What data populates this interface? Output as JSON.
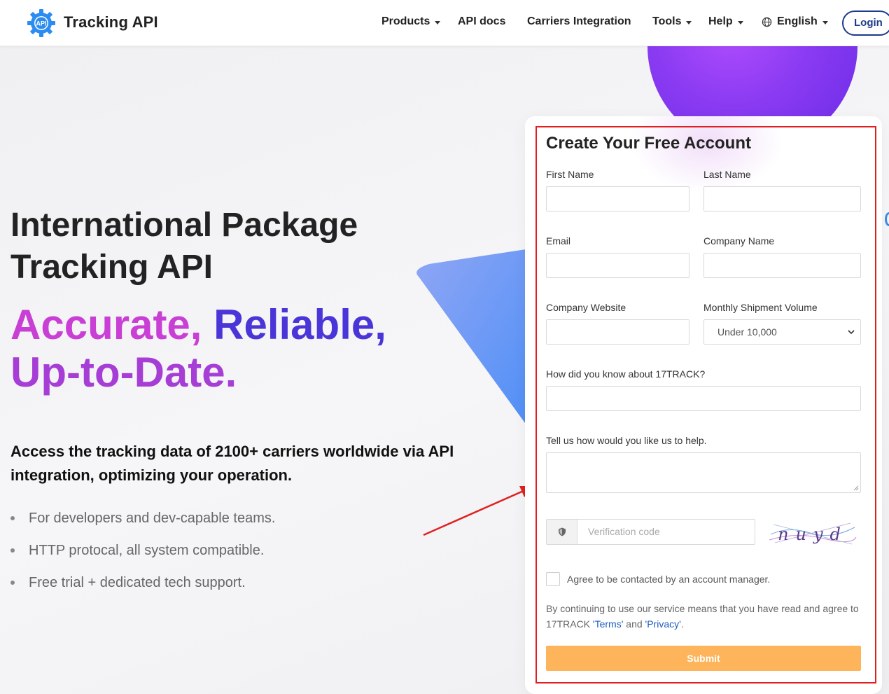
{
  "header": {
    "brand": "Tracking API",
    "logo_text": "API",
    "nav": {
      "products": "Products",
      "api_docs": "API docs",
      "carriers": "Carriers Integration",
      "tools": "Tools",
      "help": "Help",
      "language": "English"
    },
    "login": "Login"
  },
  "hero": {
    "title_line1": "International Package",
    "title_line2": "Tracking API",
    "tagline_1": "Accurate,",
    "tagline_2": " Reliable,",
    "tagline_3": "Up-to-Date.",
    "description": "Access the tracking data of 2100+ carriers worldwide via API integration, optimizing your operation.",
    "features": [
      "For developers and dev-capable teams.",
      "HTTP protocal, all system compatible.",
      "Free trial + dedicated tech support."
    ]
  },
  "form": {
    "title": "Create Your Free Account",
    "first_name_label": "First Name",
    "last_name_label": "Last Name",
    "email_label": "Email",
    "company_name_label": "Company Name",
    "company_website_label": "Company Website",
    "volume_label": "Monthly Shipment Volume",
    "volume_value": "Under 10,000",
    "source_label": "How did you know about 17TRACK?",
    "help_label": "Tell us how would you like us to help.",
    "verification_placeholder": "Verification code",
    "captcha_text": "nuyd",
    "agree_label": "Agree to be contacted by an account manager.",
    "terms_prefix": "By continuing to use our service means that you have read and agree to 17TRACK ",
    "terms_link": "'Terms'",
    "terms_and": " and ",
    "privacy_link": "'Privacy'",
    "terms_suffix": ".",
    "submit": "Submit"
  },
  "colors": {
    "submit_bg": "#fdb45a",
    "login_border": "#1d3a8a",
    "annotation_red": "#e02020",
    "tagline_pink": "#c93fd6",
    "tagline_indigo": "#4a35d8"
  }
}
